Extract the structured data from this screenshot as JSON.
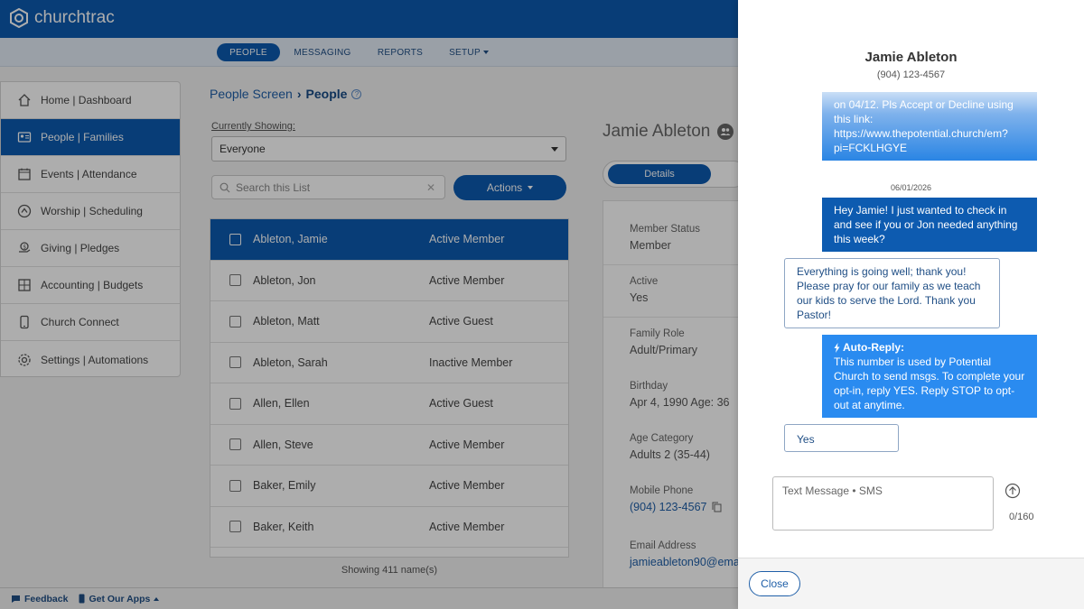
{
  "brand": {
    "name_light": "church",
    "name_bold": "trac"
  },
  "nav": {
    "items": [
      {
        "label": "PEOPLE",
        "active": true
      },
      {
        "label": "MESSAGING"
      },
      {
        "label": "REPORTS"
      },
      {
        "label": "SETUP"
      }
    ]
  },
  "sidebar": {
    "items": [
      {
        "label": "Home | Dashboard",
        "icon": "home-icon"
      },
      {
        "label": "People | Families",
        "icon": "id-card-icon",
        "active": true
      },
      {
        "label": "Events | Attendance",
        "icon": "calendar-icon"
      },
      {
        "label": "Worship | Scheduling",
        "icon": "compass-icon"
      },
      {
        "label": "Giving | Pledges",
        "icon": "giving-icon"
      },
      {
        "label": "Accounting | Budgets",
        "icon": "calculator-icon"
      },
      {
        "label": "Church Connect",
        "icon": "phone-icon"
      },
      {
        "label": "Settings | Automations",
        "icon": "gear-icon"
      }
    ]
  },
  "main": {
    "breadcrumb_parent": "People Screen",
    "breadcrumb_current": "People",
    "currently_showing_label": "Currently Showing:",
    "filter_value": "Everyone",
    "search_placeholder": "Search this List",
    "actions_label": "Actions",
    "rows": [
      {
        "name": "Ableton, Jamie",
        "status": "Active Member",
        "selected": true
      },
      {
        "name": "Ableton, Jon",
        "status": "Active Member"
      },
      {
        "name": "Ableton, Matt",
        "status": "Active Guest"
      },
      {
        "name": "Ableton, Sarah",
        "status": "Inactive Member"
      },
      {
        "name": "Allen, Ellen",
        "status": "Active Guest"
      },
      {
        "name": "Allen, Steve",
        "status": "Active Member"
      },
      {
        "name": "Baker, Emily",
        "status": "Active Member"
      },
      {
        "name": "Baker, Keith",
        "status": "Active Member"
      }
    ],
    "showing_text": "Showing 411 name(s)"
  },
  "detail": {
    "name": "Jamie Ableton",
    "tab_label": "Details",
    "fields": [
      {
        "label": "Member Status",
        "value": "Member"
      },
      {
        "label": "Active",
        "value": "Yes"
      },
      {
        "label": "Family Role",
        "value": "Adult/Primary"
      },
      {
        "label": "Birthday",
        "value": "Apr 4, 1990 Age: 36"
      },
      {
        "label": "Age Category",
        "value": "Adults 2 (35-44)"
      },
      {
        "label": "Mobile Phone",
        "value": "(904) 123-4567",
        "link": true
      },
      {
        "label": "Email Address",
        "value": "jamieableton90@ema",
        "link": true
      }
    ]
  },
  "footer": {
    "feedback": "Feedback",
    "apps": "Get Our Apps"
  },
  "messages": {
    "contact_name": "Jamie Ableton",
    "contact_phone": "(904) 123-4567",
    "faded_text": "on 04/12. Pls Accept or Decline using this link: https://www.thepotential.church/em?pi=FCKLHGYE",
    "date_label": "06/01/2026",
    "outgoing_1": "Hey Jamie! I just wanted to check in and see if you or Jon needed anything this week?",
    "incoming_1": "Everything is going well; thank you! Please pray for our family as we teach our kids to serve the Lord. Thank you Pastor!",
    "auto_title": "Auto-Reply:",
    "auto_text": "This number is used by Potential Church to send msgs. To complete your opt-in, reply YES. Reply STOP to opt-out at anytime.",
    "incoming_2": "Yes",
    "compose_placeholder": "Text Message • SMS",
    "counter": "0/160",
    "close_label": "Close"
  }
}
